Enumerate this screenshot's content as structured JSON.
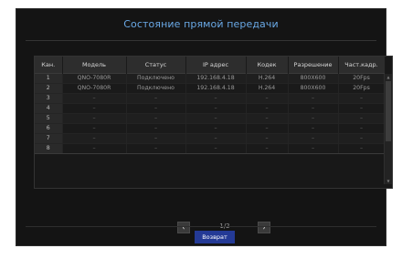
{
  "dialog": {
    "title": "Состояние прямой передачи",
    "back_label": "Возврат"
  },
  "table": {
    "headers": [
      "Кан.",
      "Модель",
      "Статус",
      "IP адрес",
      "Кодек",
      "Разрешение",
      "Част.кадр."
    ],
    "rows": [
      [
        "1",
        "QNO-7080R",
        "Подключено",
        "192.168.4.18",
        "H.264",
        "800X600",
        "20Fps"
      ],
      [
        "2",
        "QNO-7080R",
        "Подключено",
        "192.168.4.18",
        "H.264",
        "800X600",
        "20Fps"
      ],
      [
        "3",
        "–",
        "–",
        "–",
        "–",
        "–",
        "–"
      ],
      [
        "4",
        "–",
        "–",
        "–",
        "–",
        "–",
        "–"
      ],
      [
        "5",
        "–",
        "–",
        "–",
        "–",
        "–",
        "–"
      ],
      [
        "6",
        "–",
        "–",
        "–",
        "–",
        "–",
        "–"
      ],
      [
        "7",
        "–",
        "–",
        "–",
        "–",
        "–",
        "–"
      ],
      [
        "8",
        "–",
        "–",
        "–",
        "–",
        "–",
        "–"
      ]
    ]
  },
  "pager": {
    "prev_icon": "chevron-left-icon",
    "next_icon": "chevron-right-icon",
    "prev_glyph": "‹",
    "next_glyph": "›",
    "page_text": "1/2"
  },
  "scrollbar": {
    "up_glyph": "▲",
    "down_glyph": "▼"
  },
  "colors": {
    "title": "#6aa9e6",
    "back_button": "#243a96",
    "background": "#141414"
  }
}
